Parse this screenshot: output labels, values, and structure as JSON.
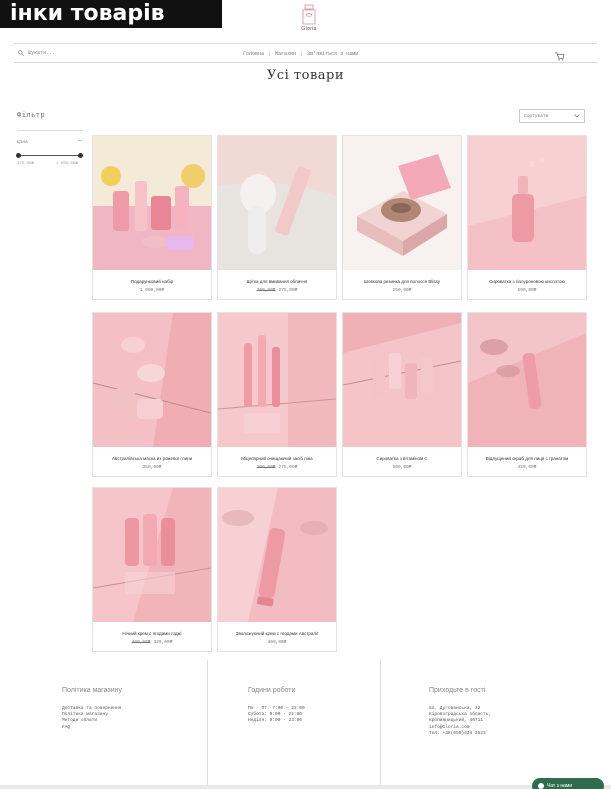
{
  "banner": {
    "text": "інки товарів"
  },
  "brand": {
    "name": "Gloria"
  },
  "header": {
    "search_label": "Шукати...",
    "nav": [
      "Головна",
      "Магазин",
      "Зв'яжіться з нами"
    ]
  },
  "page": {
    "title": "Усі товари"
  },
  "sidebar": {
    "filter_title": "Фільтр",
    "price": {
      "label": "Ціна",
      "min": "275,00₴",
      "max": "1 000,00₴"
    }
  },
  "sort": {
    "label": "Сортувати"
  },
  "products": [
    {
      "name": "Подарунковий набір",
      "old_price": "",
      "price": "1 000,00₴"
    },
    {
      "name": "Щітка для вмивання обличчя",
      "old_price": "300,00₴",
      "price": "275,00₴"
    },
    {
      "name": "Шовкова резинка для волосся Blissy",
      "old_price": "",
      "price": "250,00₴"
    },
    {
      "name": "Сироватка з гіалуроновою кислотою",
      "old_price": "",
      "price": "500,00₴"
    },
    {
      "name": "Австралійська маска из рожевої глини",
      "old_price": "",
      "price": "350,00₴"
    },
    {
      "name": "Міцелярний очищаючий засіб піна",
      "old_price": "300,00₴",
      "price": "275,00₴"
    },
    {
      "name": "Сироватка з вітаміном С",
      "old_price": "",
      "price": "500,00₴"
    },
    {
      "name": "Відлущений скраб для лиця с гранатом",
      "old_price": "",
      "price": "450,00₴"
    },
    {
      "name": "Нічний крем с ягодами годжі",
      "old_price": "400,00₴",
      "price": "320,00₴"
    },
    {
      "name": "Зволожуючий крем с ягодами Австралії",
      "old_price": "",
      "price": "400,00₴"
    }
  ],
  "footer": {
    "policy": {
      "title": "Політика магазину",
      "lines": [
        "Доставка та повернення",
        "Політика магазину",
        "Методи оплати",
        "FAQ"
      ]
    },
    "hours": {
      "title": "Години роботи",
      "lines": [
        "Пн - Пт: 7:00 - 22:00",
        "Субота: 9:00 - 22:00",
        "Неділя: 9:00 - 23:00"
      ]
    },
    "visit": {
      "title": "Приходьте в гості",
      "lines": [
        "вл. Дугованська, 32",
        "Кіровоградська область,",
        "Кропивницький, 40711",
        "info@Gloria.com",
        "Тел: +38(050)434 3523"
      ]
    }
  },
  "chat": {
    "label": "Чат з нами"
  },
  "colors": {
    "pink": "#f2c6c9",
    "accent_dark": "#111111",
    "chat_green": "#2e6b4f"
  }
}
